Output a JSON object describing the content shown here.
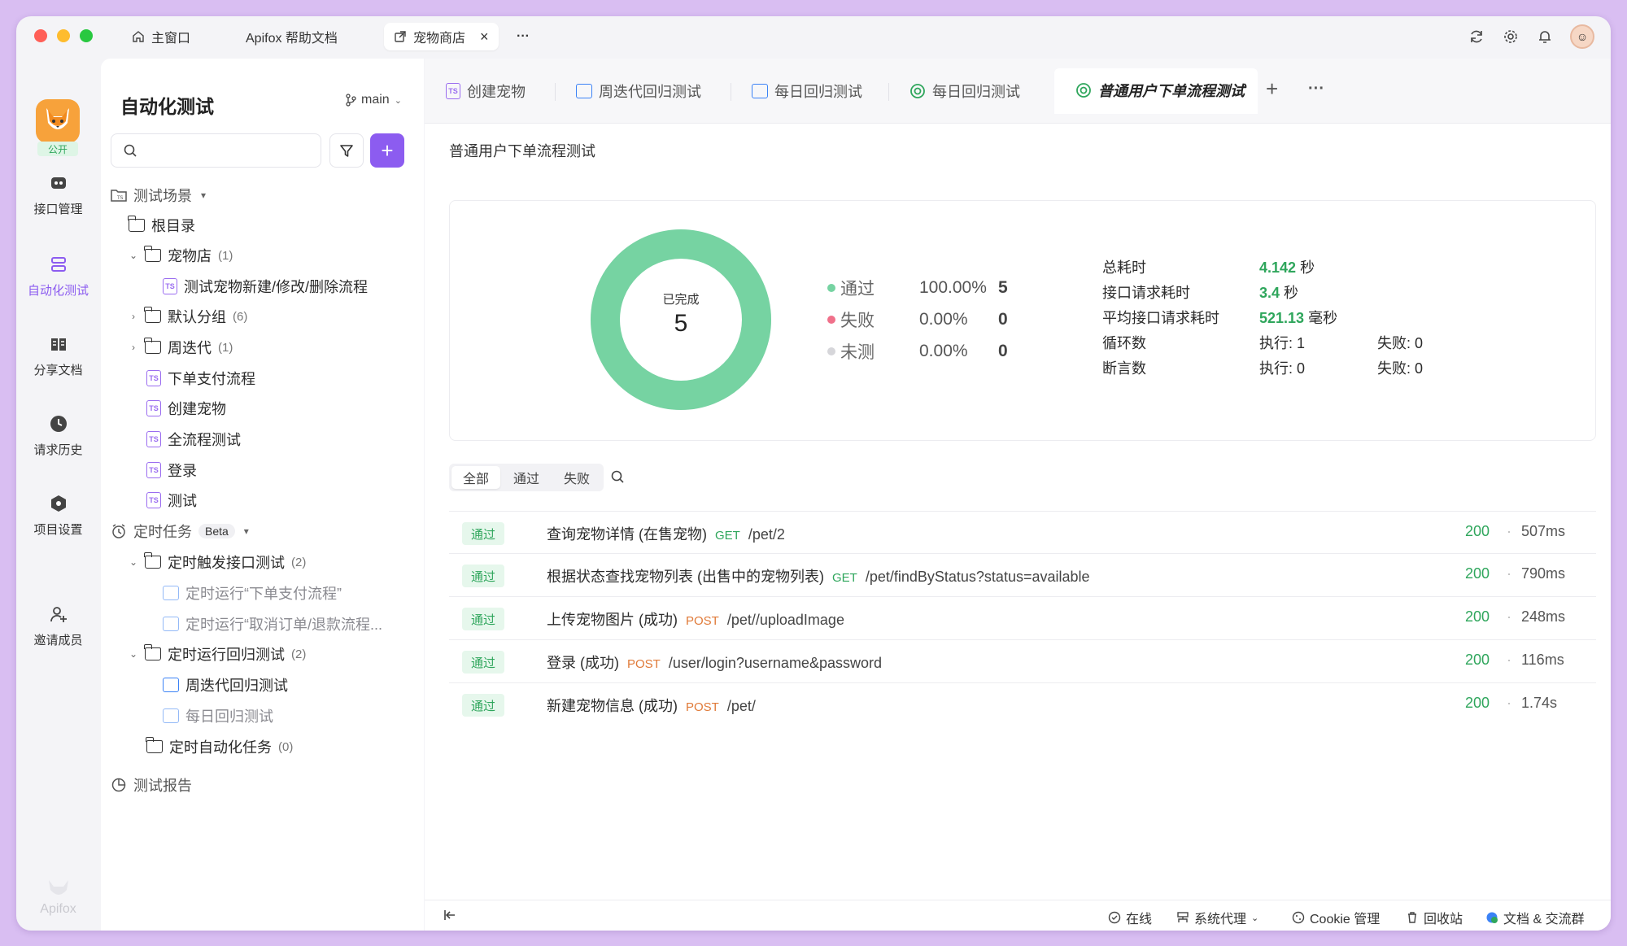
{
  "titlebar": {
    "tabs": [
      {
        "label": "主窗口",
        "icon": "home-icon"
      },
      {
        "label": "Apifox 帮助文档",
        "icon": ""
      },
      {
        "label": "宠物商店",
        "icon": "external-icon",
        "close": "×"
      }
    ],
    "more": "···"
  },
  "rail": {
    "public_badge": "公开",
    "items": [
      {
        "label": "接口管理",
        "icon": "api-icon"
      },
      {
        "label": "自动化测试",
        "icon": "automation-icon",
        "active": true
      },
      {
        "label": "分享文档",
        "icon": "book-icon"
      },
      {
        "label": "请求历史",
        "icon": "clock-icon"
      },
      {
        "label": "项目设置",
        "icon": "settings-icon"
      },
      {
        "label": "邀请成员",
        "icon": "add-user-icon"
      }
    ],
    "footer_brand": "Apifox"
  },
  "sidebar": {
    "title": "自动化测试",
    "branch": "main",
    "search_placeholder": "",
    "add": "+",
    "tree": {
      "scenarios": "测试场景",
      "root": "根目录",
      "pet_store": "宠物店",
      "pet_store_count": "(1)",
      "pet_store_child": "测试宠物新建/修改/删除流程",
      "default_group": "默认分组",
      "default_group_count": "(6)",
      "iteration": "周迭代",
      "iteration_count": "(1)",
      "order_pay": "下单支付流程",
      "create_pet": "创建宠物",
      "full_flow": "全流程测试",
      "login": "登录",
      "test": "测试",
      "scheduled": "定时任务",
      "beta": "Beta",
      "trigger": "定时触发接口测试",
      "trigger_count": "(2)",
      "trigger_a": "定时运行“下单支付流程”",
      "trigger_b": "定时运行“取消订单/退款流程...",
      "regression": "定时运行回归测试",
      "regression_count": "(2)",
      "weekly": "周迭代回归测试",
      "daily": "每日回归测试",
      "auto_tasks": "定时自动化任务",
      "auto_tasks_count": "(0)",
      "reports": "测试报告"
    }
  },
  "main": {
    "tabs": [
      {
        "label": "创建宠物",
        "icon": "ts-icon"
      },
      {
        "label": "周迭代回归测试",
        "icon": "calendar-icon"
      },
      {
        "label": "每日回归测试",
        "icon": "calendar-icon"
      },
      {
        "label": "每日回归测试",
        "icon": "report-icon"
      },
      {
        "label": "普通用户下单流程测试",
        "icon": "report-icon",
        "active": true
      }
    ],
    "add_tab": "+",
    "more_tab": "···",
    "page_title": "普通用户下单流程测试",
    "summary": {
      "donut_label": "已完成",
      "donut_value": "5",
      "pass_fraction": 1.0,
      "colors": {
        "pass": "#76d3a2",
        "fail": "#f0708a",
        "untested": "#d6d6da"
      },
      "legend": [
        {
          "label": "通过",
          "pct": "100.00%",
          "count": "5"
        },
        {
          "label": "失败",
          "pct": "0.00%",
          "count": "0"
        },
        {
          "label": "未测",
          "pct": "0.00%",
          "count": "0"
        }
      ],
      "stats": {
        "total_time_label": "总耗时",
        "total_time": "4.142",
        "total_time_unit": "秒",
        "request_time_label": "接口请求耗时",
        "request_time": "3.4",
        "request_time_unit": "秒",
        "avg_time_label": "平均接口请求耗时",
        "avg_time": "521.13",
        "avg_time_unit": "毫秒",
        "loops_label": "循环数",
        "loops_exec": "执行: 1",
        "loops_fail": "失败: 0",
        "asserts_label": "断言数",
        "asserts_exec": "执行: 0",
        "asserts_fail": "失败: 0"
      }
    },
    "filters": [
      "全部",
      "通过",
      "失败"
    ],
    "results": [
      {
        "badge": "通过",
        "name": "查询宠物详情 (在售宠物)",
        "method": "GET",
        "path": "/pet/2",
        "status": "200",
        "dot": "·",
        "time": "507ms"
      },
      {
        "badge": "通过",
        "name": "根据状态查找宠物列表 (出售中的宠物列表)",
        "method": "GET",
        "path": "/pet/findByStatus?status=available",
        "status": "200",
        "dot": "·",
        "time": "790ms"
      },
      {
        "badge": "通过",
        "name": "上传宠物图片 (成功)",
        "method": "POST",
        "path": "/pet//uploadImage",
        "status": "200",
        "dot": "·",
        "time": "248ms"
      },
      {
        "badge": "通过",
        "name": "登录 (成功)",
        "method": "POST",
        "path": "/user/login?username&password",
        "status": "200",
        "dot": "·",
        "time": "116ms"
      },
      {
        "badge": "通过",
        "name": "新建宠物信息 (成功)",
        "method": "POST",
        "path": "/pet/",
        "status": "200",
        "dot": "·",
        "time": "1.74s"
      }
    ],
    "footer": {
      "online": "在线",
      "proxy": "系统代理",
      "cookie": "Cookie 管理",
      "trash": "回收站",
      "docs": "文档 & 交流群"
    }
  }
}
